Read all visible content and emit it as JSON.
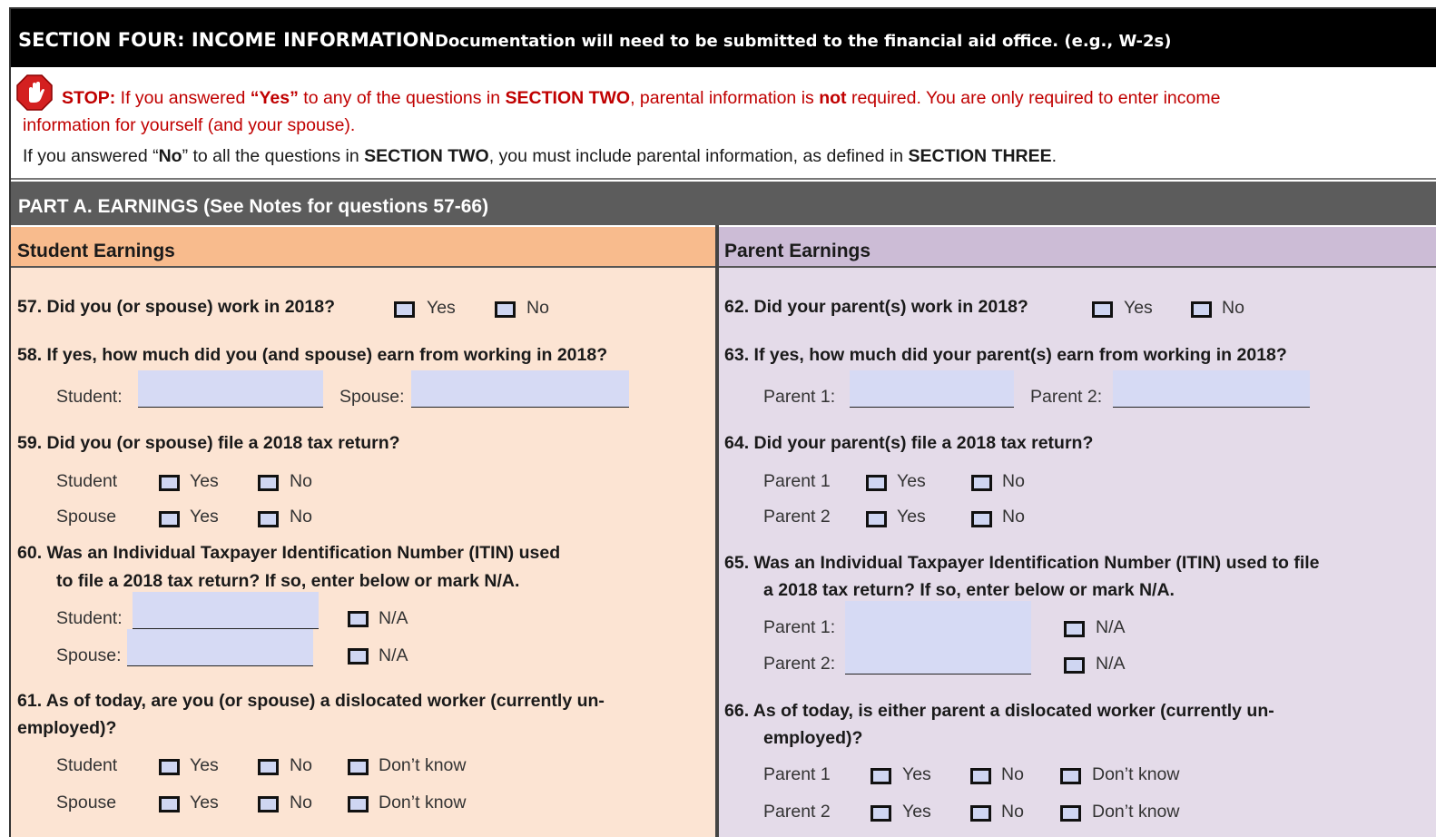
{
  "header": {
    "title": "SECTION FOUR: INCOME INFORMATION",
    "doc_note": "Documentation will need to be submitted to the financial aid office. (e.g., W-2s)"
  },
  "stop": {
    "lead": "STOP:",
    "t1": " If you answered ",
    "yes": "“Yes”",
    "t2": " to any of the questions in ",
    "sec2": "SECTION TWO",
    "t3": ", parental information is ",
    "not": "not",
    "t4": " required. You are only required to enter income",
    "line2": "information for yourself (and your spouse).",
    "icon": "stop-hand-icon"
  },
  "note": {
    "t1": "If you answered “",
    "no": "No",
    "t2": "” to all the questions in ",
    "sec2": "SECTION TWO",
    "t3": ", you must include parental information, as defined in ",
    "sec3": "SECTION THREE",
    "t4": "."
  },
  "part_a": {
    "title": "PART A. EARNINGS  (See Notes for questions 57-66)"
  },
  "student": {
    "heading": "Student Earnings",
    "q57": "57. Did you (or spouse) work in 2018?",
    "q58": "58. If yes, how much did you (and spouse) earn from working in 2018?",
    "q58_student": "Student:",
    "q58_spouse": "Spouse:",
    "q59": "59. Did you (or spouse) file a 2018 tax return?",
    "row_student": "Student",
    "row_spouse": "Spouse",
    "q60_line1": "60. Was an Individual Taxpayer Identification Number (ITIN) used",
    "q60_line2": "to file a 2018 tax return? If so, enter below or mark N/A.",
    "q60_student": "Student:",
    "q60_spouse": "Spouse:",
    "q61_line1": "61. As of today, are you (or spouse) a dislocated worker (currently un-",
    "q61_line2": "employed)?"
  },
  "parent": {
    "heading": "Parent Earnings",
    "q62": "62. Did your parent(s) work in 2018?",
    "q63": "63. If yes, how much did your parent(s) earn from working in 2018?",
    "p1_colon": "Parent 1:",
    "p2_colon": "Parent 2:",
    "q64": "64. Did your parent(s) file a 2018 tax return?",
    "p1": "Parent 1",
    "p2": "Parent 2",
    "q65_line1": "65. Was an Individual Taxpayer Identification Number (ITIN) used to file",
    "q65_line2": "a 2018 tax return? If so, enter below or mark N/A.",
    "q66_line1": "66. As of today, is either parent a dislocated worker (currently un-",
    "q66_line2": "employed)?"
  },
  "opts": {
    "yes": "Yes",
    "no": "No",
    "na": "N/A",
    "dk": "Don’t know"
  }
}
